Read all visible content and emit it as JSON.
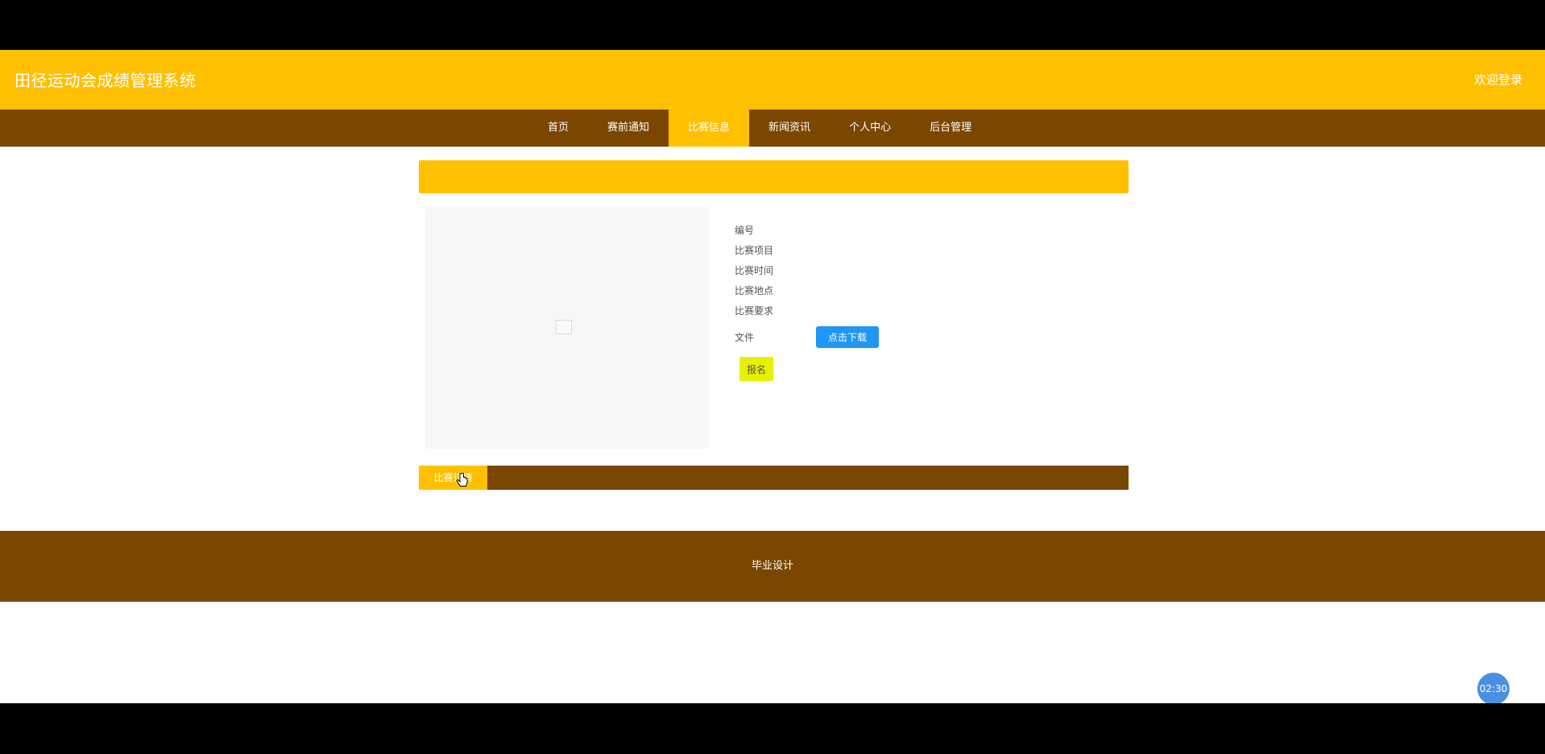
{
  "header": {
    "site_title": "田径运动会成绩管理系统",
    "right_text": "欢迎登录"
  },
  "nav": {
    "items": [
      {
        "label": "首页"
      },
      {
        "label": "赛前通知"
      },
      {
        "label": "比赛信息"
      },
      {
        "label": "新闻资讯"
      },
      {
        "label": "个人中心"
      },
      {
        "label": "后台管理"
      }
    ],
    "active_index": 2
  },
  "detail": {
    "fields": [
      {
        "label": "编号"
      },
      {
        "label": "比赛项目"
      },
      {
        "label": "比赛时间"
      },
      {
        "label": "比赛地点"
      },
      {
        "label": "比赛要求"
      }
    ],
    "file_label": "文件",
    "download_label": "点击下载",
    "signup_label": "报名"
  },
  "tabs": {
    "active_label": "比赛详情"
  },
  "footer": {
    "text": "毕业设计"
  },
  "timer": {
    "text": "02:30"
  },
  "colors": {
    "header": "#ffc000",
    "nav": "#7a4600",
    "download_button": "#2196f3",
    "signup_button": "#e6f000",
    "timer": "#4a90e2"
  }
}
